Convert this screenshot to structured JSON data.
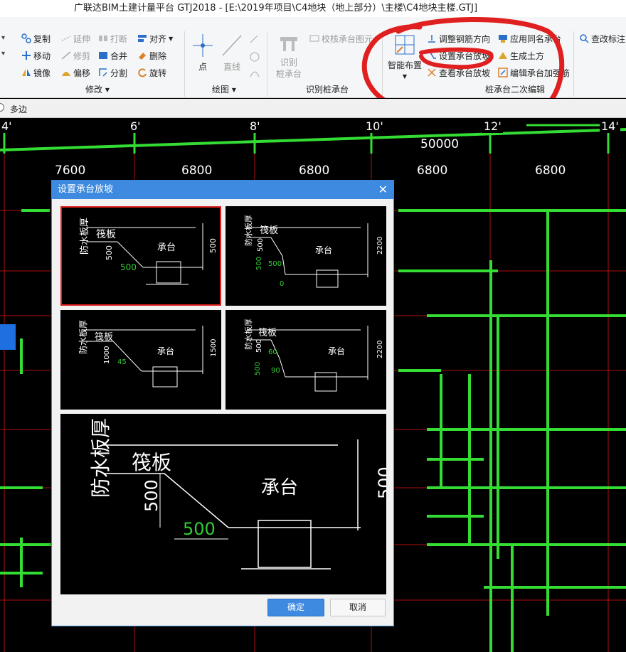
{
  "window": {
    "title": "广联达BIM土建计量平台 GTJ2018 - [E:\\2019年项目\\C4地块（地上部分）\\主楼\\C4地块主楼.GTJ]"
  },
  "ribbon": {
    "modify": {
      "copy": "复制",
      "extend": "延伸",
      "break": "打断",
      "align": "对齐",
      "move": "移动",
      "trim": "修剪",
      "merge": "合并",
      "delete": "删除",
      "mirror": "镜像",
      "offset": "偏移",
      "split": "分割",
      "rotate": "旋转",
      "group_label": "修改"
    },
    "draw": {
      "point": "点",
      "line": "直线",
      "group_label": "绘图"
    },
    "identify": {
      "check_label": "校核承台图元",
      "identify_btn": "识别\n桩承台",
      "group_label": "识别桩承台"
    },
    "secondary": {
      "smart_layout": "智能布置",
      "adjust_rebar": "调整钢筋方向",
      "apply_same": "应用同名承台",
      "set_slope": "设置承台放坡",
      "gen_earth": "生成土方",
      "view_slope": "查看承台放坡",
      "edit_rebar": "编辑承台加强筋",
      "group_label": "桩承台二次编辑"
    },
    "extra": {
      "query_label": "查改标注"
    }
  },
  "option_bar": {
    "polygon": "多边"
  },
  "canvas": {
    "axes": [
      "4'",
      "6'",
      "8'",
      "10'",
      "12'",
      "14'"
    ],
    "dims": [
      "7600",
      "6800",
      "6800",
      "6800",
      "6800"
    ],
    "overall": "50000"
  },
  "dialog": {
    "title": "设置承台放坡",
    "options": [
      {
        "waterproof": "防水板厚",
        "raft": "筏板",
        "cap": "承台",
        "depth": "500",
        "run": "500",
        "height": "500"
      },
      {
        "waterproof": "防水板厚",
        "raft": "筏板",
        "cap": "承台",
        "depth": "500",
        "depth_green": "500",
        "run": "500",
        "zero": "0",
        "height": "2200"
      },
      {
        "waterproof": "防水板厚",
        "raft": "筏板",
        "cap": "承台",
        "depth": "1000",
        "angle": "45",
        "height": "1500"
      },
      {
        "waterproof": "防水板厚",
        "raft": "筏板",
        "cap": "承台",
        "depth": "500",
        "depth_green": "500",
        "angle1": "60",
        "angle2": "90",
        "height": "2200"
      }
    ],
    "preview": {
      "waterproof": "防水板厚",
      "raft": "筏板",
      "cap": "承台",
      "depth": "500",
      "run": "500",
      "height": "500"
    },
    "selected_index": 0,
    "ok": "确定",
    "cancel": "取消"
  },
  "colors": {
    "green": "#33dd33",
    "red_grid": "#b01010",
    "dialog_title": "#3d8ae0",
    "annotation": "#e02020"
  }
}
